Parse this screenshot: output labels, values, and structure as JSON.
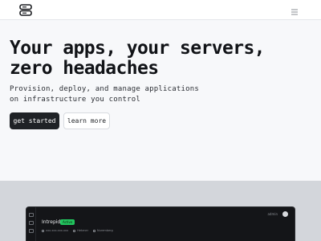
{
  "nav": {
    "logo_icon": "server-stack-icon",
    "menu_icon": "hamburger-menu-icon"
  },
  "hero": {
    "headline_line1": "Your apps, your servers,",
    "headline_line2": "zero headaches",
    "sub_line1": "Provision, deploy, and manage applications",
    "sub_line2": "on infrastructure you control",
    "primary_cta": "get started",
    "secondary_cta": "learn more"
  },
  "preview": {
    "app_name": "Intrepid",
    "status": "Active",
    "meta": [
      "xxx.xxx.xxx.xxx",
      "Hetzner",
      "Nuremberg"
    ],
    "top_label": "admin"
  },
  "colors": {
    "primary_button": "#1f2226",
    "status_green": "#22c55e",
    "band": "#d3d6db",
    "dashboard": "#141518"
  }
}
